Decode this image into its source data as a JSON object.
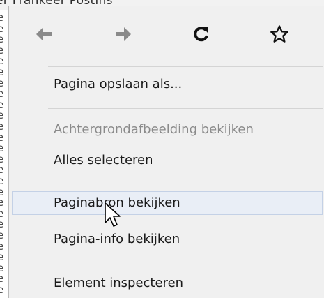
{
  "background": {
    "tab_text": "er   Frankeer   Postins",
    "left_fragments": [
      "e",
      "e",
      "e",
      "e",
      "e",
      "e",
      "e",
      "e",
      "e",
      "e",
      "e",
      "e",
      "e",
      "e",
      "e",
      "e",
      "e",
      "e",
      "e",
      "e",
      "e",
      "e",
      "e",
      "e",
      "e",
      "e"
    ]
  },
  "nav": {
    "back_icon": "arrow-left-icon",
    "forward_icon": "arrow-right-icon",
    "reload_icon": "reload-icon",
    "bookmark_icon": "star-icon",
    "icon_color": "#7a7a7a",
    "dark_icon_color": "#111111"
  },
  "menu": {
    "items": [
      {
        "label": "Pagina opslaan als...",
        "enabled": true
      },
      {
        "label": "Achtergrondafbeelding bekijken",
        "enabled": false
      },
      {
        "label": "Alles selecteren",
        "enabled": true
      },
      {
        "label": "Paginabron bekijken",
        "enabled": true,
        "hovered": true
      },
      {
        "label": "Pagina-info bekijken",
        "enabled": true
      },
      {
        "label": "Element inspecteren",
        "enabled": true
      }
    ]
  },
  "colors": {
    "menu_bg": "#f0f0f0",
    "hover_bg": "#e9eef6",
    "hover_border": "#c4d1e6",
    "disabled_text": "#8a8a8a"
  }
}
